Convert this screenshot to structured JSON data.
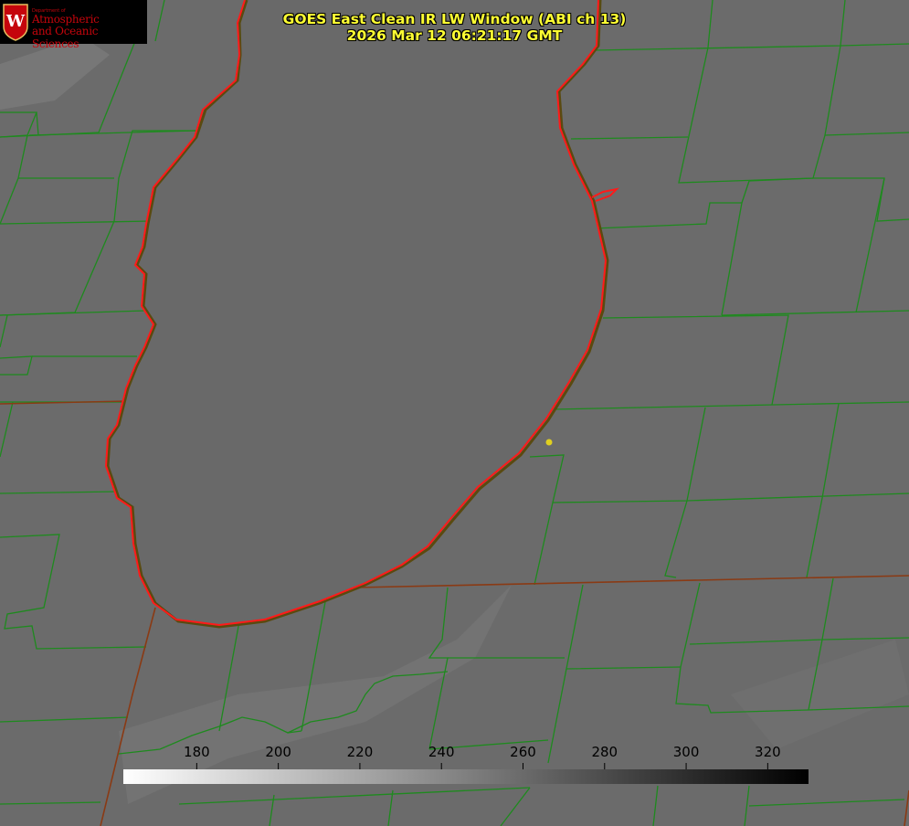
{
  "logo": {
    "small_text": "Department of",
    "line1": "Atmospheric",
    "line2": "and Oceanic Sciences",
    "crest_letter": "W",
    "icon": "uw-crest-icon"
  },
  "title": {
    "line1": "GOES East Clean IR LW Window (ABI ch 13)",
    "line2": "2026 Mar 12 06:21:17 GMT"
  },
  "colorbar": {
    "min": 162,
    "max": 330,
    "colors": {
      "low": "#ffffff",
      "high": "#000000"
    },
    "ticks": [
      {
        "value": 180,
        "label": "180"
      },
      {
        "value": 200,
        "label": "200"
      },
      {
        "value": 220,
        "label": "220"
      },
      {
        "value": 240,
        "label": "240"
      },
      {
        "value": 260,
        "label": "260"
      },
      {
        "value": 280,
        "label": "280"
      },
      {
        "value": 300,
        "label": "300"
      },
      {
        "value": 320,
        "label": "320"
      }
    ]
  },
  "map_colors": {
    "background": "#6a6a6a",
    "lake": "#696969",
    "county_lines": "#1e8a1e",
    "state_lines": "#8a3a14",
    "coastline": "#ff1a1a",
    "marker": "#e0d020"
  }
}
